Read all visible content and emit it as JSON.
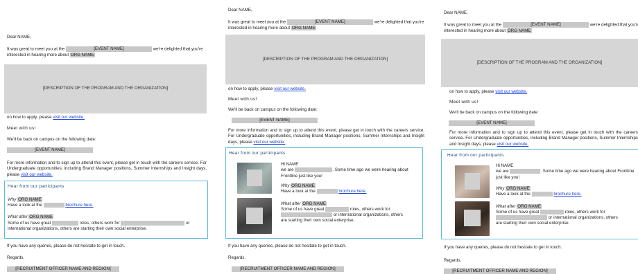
{
  "email": {
    "greeting": "Dear NAME,",
    "intro_prefix": "It was great to meet you at the",
    "event_placeholder": "[EVENT NAME]",
    "intro_middle": "we're delighted that you're interested in hearing more about",
    "org_name": "ORG NAME",
    "description_placeholder": "[DESCRIPTION OF THE PROGRAM AND THE ORGANIZATION]",
    "apply_text": "on how to apply, please",
    "apply_link": "visit our website.",
    "meet_heading": "Meet with us!",
    "campus_text": "We'll be back on campus on the following date:",
    "event_bar": "[EVENT NAME]",
    "more_info": "For more information and to sign up to attend this event, please get in touch with the careers service. For Undergraduate opportunities, including Brand Manager positions, Summer Internships and Insight days, please",
    "more_info_link": "visit our website.",
    "participants_heading": "Hear from our participants",
    "why_label": "Why",
    "have_look": "Have a look at the",
    "brochure_link": "brochure here.",
    "what_after_label": "What after",
    "some_of_us": "Some of us have great",
    "roles_text": "roles, others work for",
    "or_text": "or",
    "international_text": "international organizations, others are starting their own social enterprise.",
    "or_intl_text": "or international organizations, others",
    "starting_text": "are starting their own social enterprise.",
    "hi_name": "Hi NAME",
    "we_are": "we are",
    "some_time_ago": ". Some time ago we were hearing about Frontline just like you!",
    "queries": "If you have any queries, please do not hesitate to get in touch.",
    "regards": "Regards,",
    "officer_placeholder": "[RECRUITMENT OFFICER NAME AND REGION]"
  },
  "colors": {
    "placeholder_gray": "#c8c8c8",
    "link_blue": "#1a3fd6",
    "box_border": "#5bbcd6",
    "heading_navy": "#1d4d73"
  }
}
